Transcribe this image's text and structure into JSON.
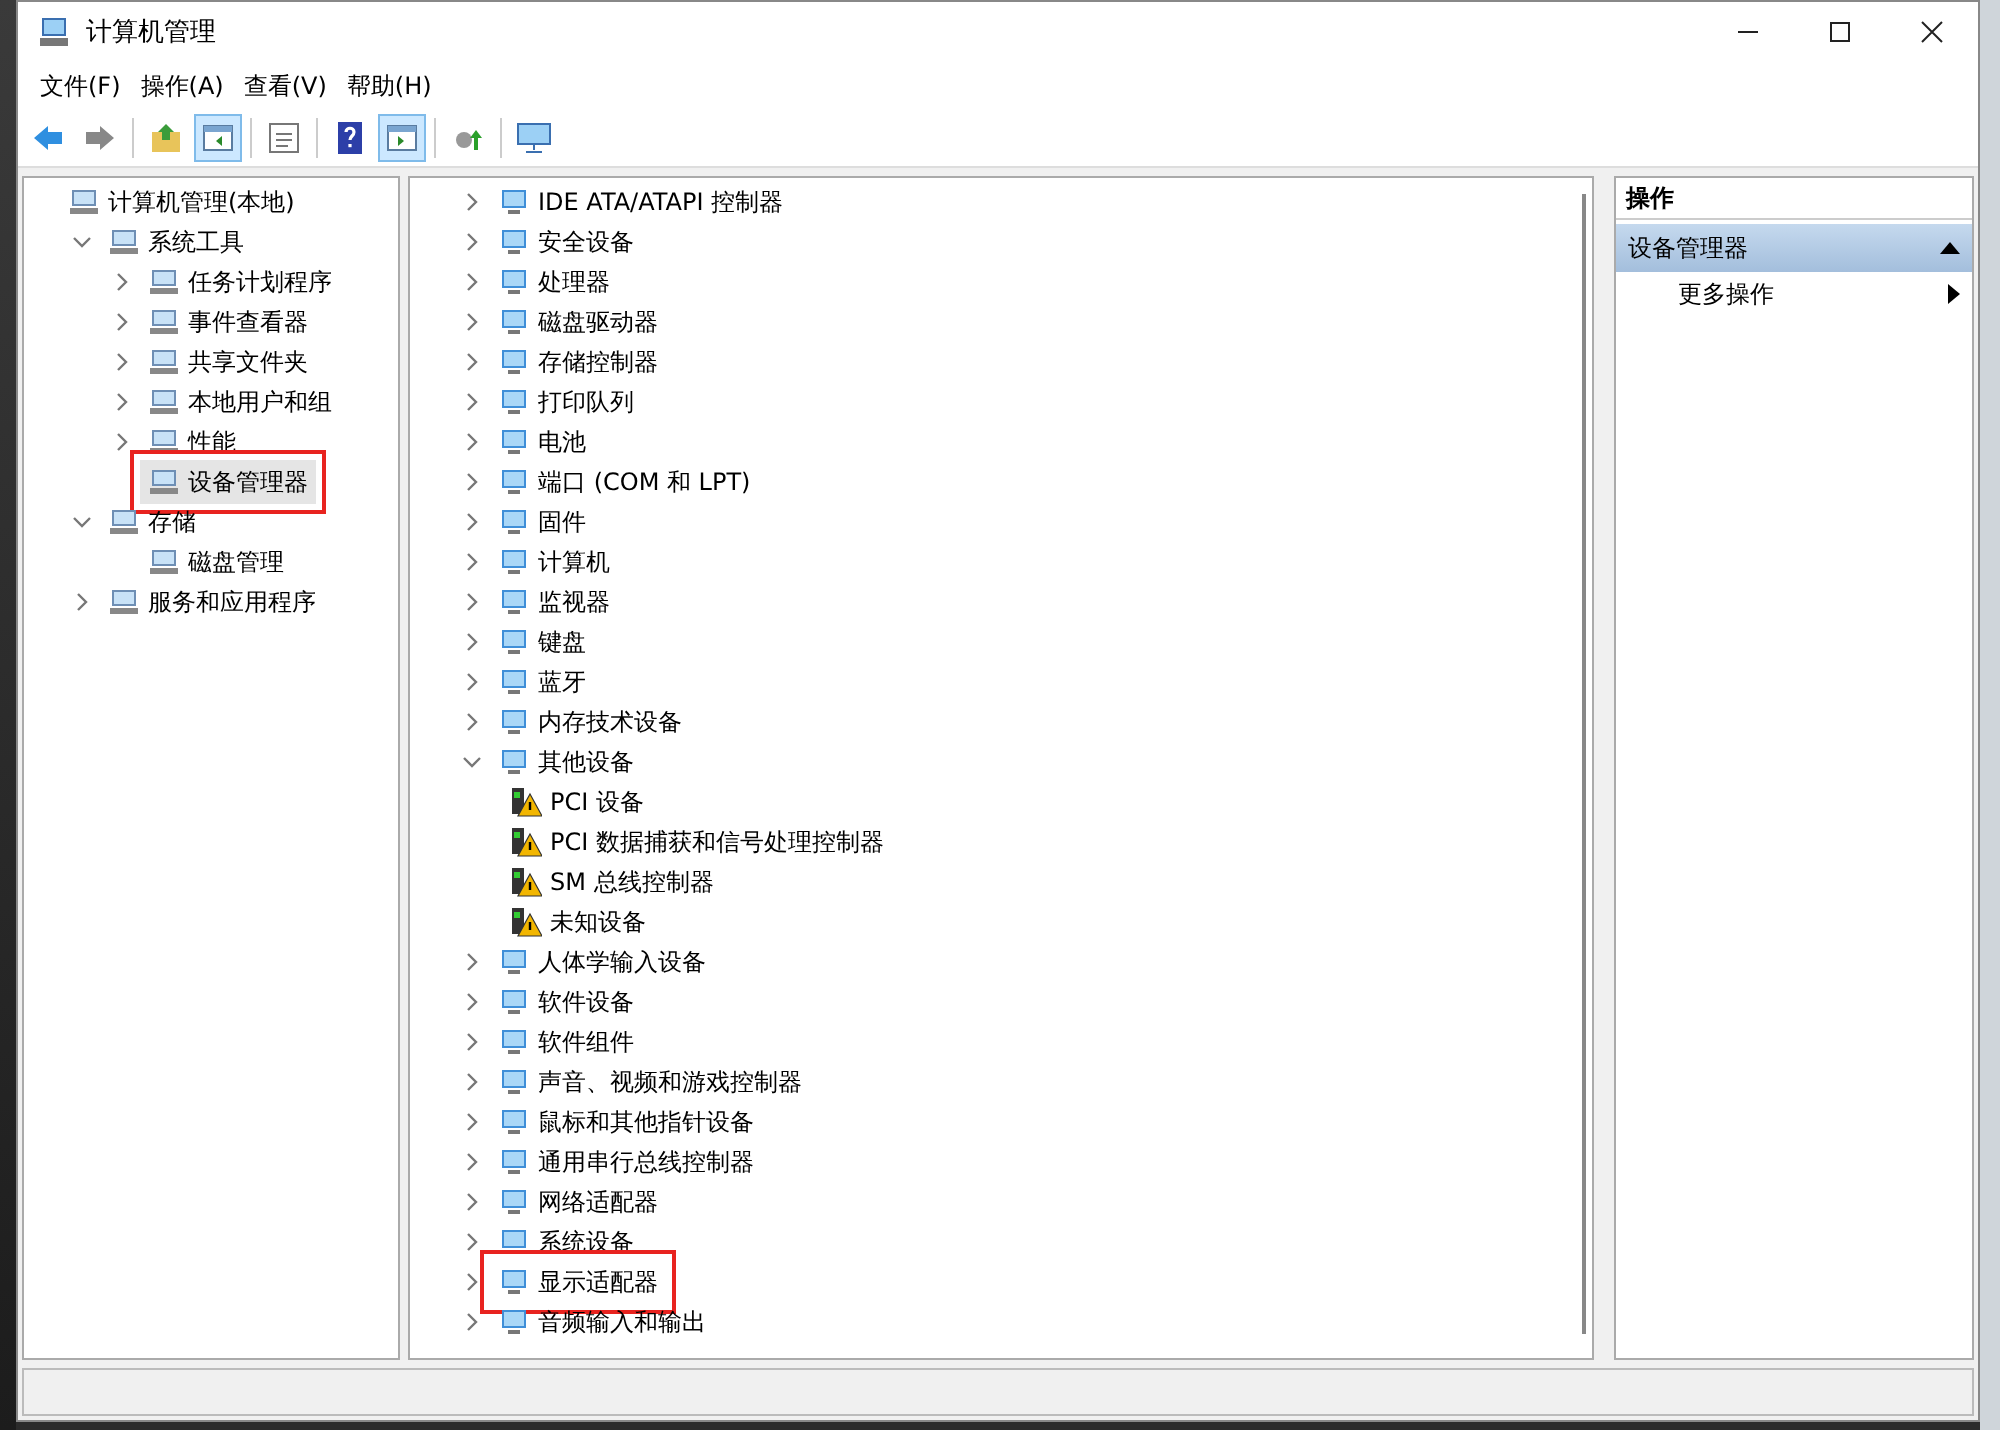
{
  "window": {
    "title": "计算机管理"
  },
  "menu": [
    "文件(F)",
    "操作(A)",
    "查看(V)",
    "帮助(H)"
  ],
  "toolbar": [
    {
      "kind": "back",
      "pressed": false
    },
    {
      "kind": "forward",
      "pressed": false
    },
    {
      "kind": "separator"
    },
    {
      "kind": "up",
      "pressed": false
    },
    {
      "kind": "tree",
      "pressed": true
    },
    {
      "kind": "separator"
    },
    {
      "kind": "properties",
      "pressed": false
    },
    {
      "kind": "separator"
    },
    {
      "kind": "help",
      "pressed": false
    },
    {
      "kind": "action-pane",
      "pressed": true
    },
    {
      "kind": "separator"
    },
    {
      "kind": "export",
      "pressed": false
    },
    {
      "kind": "separator"
    },
    {
      "kind": "monitor",
      "pressed": false
    }
  ],
  "tree": [
    {
      "label": "计算机管理(本地)",
      "selected": false,
      "annotated": false,
      "children": [
        {
          "label": "系统工具",
          "expanded": true,
          "selected": false,
          "annotated": false,
          "children": [
            {
              "label": "任务计划程序",
              "expanded": false,
              "selected": false,
              "annotated": false
            },
            {
              "label": "事件查看器",
              "expanded": false,
              "selected": false,
              "annotated": false
            },
            {
              "label": "共享文件夹",
              "expanded": false,
              "selected": false,
              "annotated": false
            },
            {
              "label": "本地用户和组",
              "expanded": false,
              "selected": false,
              "annotated": false
            },
            {
              "label": "性能",
              "expanded": false,
              "selected": false,
              "annotated": false
            },
            {
              "label": "设备管理器",
              "selected": true,
              "annotated": true
            }
          ]
        },
        {
          "label": "存储",
          "expanded": true,
          "selected": false,
          "annotated": false,
          "children": [
            {
              "label": "磁盘管理",
              "selected": false,
              "annotated": false
            }
          ]
        },
        {
          "label": "服务和应用程序",
          "expanded": false,
          "selected": false,
          "annotated": false
        }
      ]
    }
  ],
  "devices": [
    {
      "label": "IDE ATA/ATAPI 控制器",
      "expanded": false,
      "annotated": false
    },
    {
      "label": "安全设备",
      "expanded": false,
      "annotated": false
    },
    {
      "label": "处理器",
      "expanded": false,
      "annotated": false
    },
    {
      "label": "磁盘驱动器",
      "expanded": false,
      "annotated": false
    },
    {
      "label": "存储控制器",
      "expanded": false,
      "annotated": false
    },
    {
      "label": "打印队列",
      "expanded": false,
      "annotated": false
    },
    {
      "label": "电池",
      "expanded": false,
      "annotated": false
    },
    {
      "label": "端口 (COM 和 LPT)",
      "expanded": false,
      "annotated": false
    },
    {
      "label": "固件",
      "expanded": false,
      "annotated": false
    },
    {
      "label": "计算机",
      "expanded": false,
      "annotated": false
    },
    {
      "label": "监视器",
      "expanded": false,
      "annotated": false
    },
    {
      "label": "键盘",
      "expanded": false,
      "annotated": false
    },
    {
      "label": "蓝牙",
      "expanded": false,
      "annotated": false
    },
    {
      "label": "内存技术设备",
      "expanded": false,
      "annotated": false
    },
    {
      "label": "其他设备",
      "expanded": true,
      "annotated": false,
      "children": [
        {
          "label": "PCI 设备",
          "warning": true
        },
        {
          "label": "PCI 数据捕获和信号处理控制器",
          "warning": true
        },
        {
          "label": "SM 总线控制器",
          "warning": true
        },
        {
          "label": "未知设备",
          "warning": true
        }
      ]
    },
    {
      "label": "人体学输入设备",
      "expanded": false,
      "annotated": false
    },
    {
      "label": "软件设备",
      "expanded": false,
      "annotated": false
    },
    {
      "label": "软件组件",
      "expanded": false,
      "annotated": false
    },
    {
      "label": "声音、视频和游戏控制器",
      "expanded": false,
      "annotated": false
    },
    {
      "label": "鼠标和其他指针设备",
      "expanded": false,
      "annotated": false
    },
    {
      "label": "通用串行总线控制器",
      "expanded": false,
      "annotated": false
    },
    {
      "label": "网络适配器",
      "expanded": false,
      "annotated": false
    },
    {
      "label": "系统设备",
      "expanded": false,
      "annotated": false
    },
    {
      "label": "显示适配器",
      "expanded": false,
      "annotated": true
    },
    {
      "label": "音频输入和输出",
      "expanded": false,
      "annotated": false
    }
  ],
  "actions": {
    "title": "操作",
    "sections": [
      {
        "label": "设备管理器",
        "expanded": true,
        "items": [
          "更多操作"
        ]
      }
    ]
  }
}
